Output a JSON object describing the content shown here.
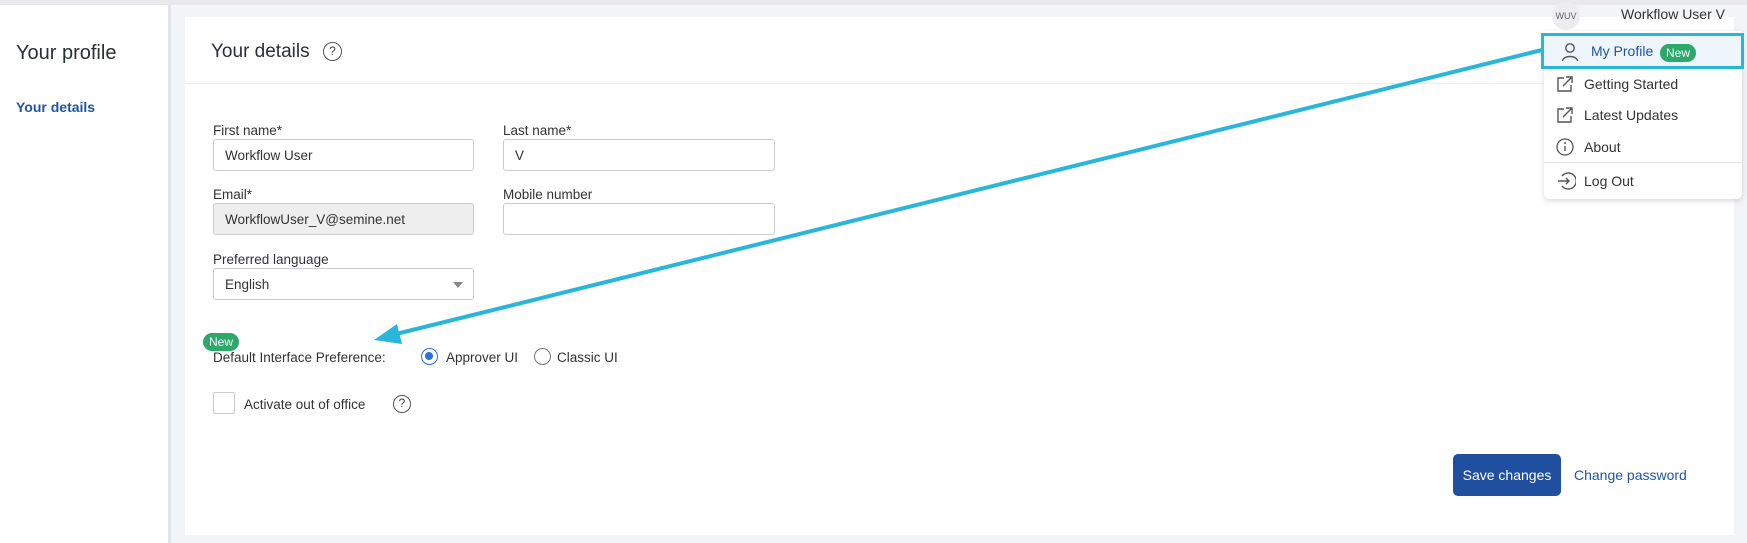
{
  "sidebar": {
    "title": "Your profile",
    "items": [
      {
        "label": "Your details"
      }
    ]
  },
  "card": {
    "title": "Your details",
    "help_glyph": "?",
    "form": {
      "first_name": {
        "label": "First name*",
        "value": "Workflow User"
      },
      "last_name": {
        "label": "Last name*",
        "value": "V"
      },
      "email": {
        "label": "Email*",
        "value": "WorkflowUser_V@semine.net"
      },
      "mobile": {
        "label": "Mobile number",
        "value": ""
      },
      "language": {
        "label": "Preferred language",
        "value": "English"
      },
      "interface_pref": {
        "badge": "New",
        "label": "Default Interface Preference:",
        "options": [
          {
            "label": "Approver UI",
            "checked": true
          },
          {
            "label": "Classic UI",
            "checked": false
          }
        ]
      },
      "out_of_office": {
        "label": "Activate out of office",
        "checked": false
      }
    },
    "actions": {
      "save": "Save changes",
      "change_password": "Change password"
    }
  },
  "user_menu": {
    "avatar_initials": "WUV",
    "user_name": "Workflow User V",
    "items": [
      {
        "label": "My Profile",
        "icon": "user-icon",
        "badge": "New"
      },
      {
        "label": "Getting Started",
        "icon": "external-link-icon"
      },
      {
        "label": "Latest Updates",
        "icon": "external-link-icon"
      },
      {
        "label": "About",
        "icon": "info-icon"
      },
      {
        "label": "Log Out",
        "icon": "logout-icon"
      }
    ]
  },
  "colors": {
    "accent": "#1f55a4",
    "primary_button": "#1f4f9e",
    "new_badge": "#2ca86b",
    "annotation_arrow": "#29b6d9"
  }
}
